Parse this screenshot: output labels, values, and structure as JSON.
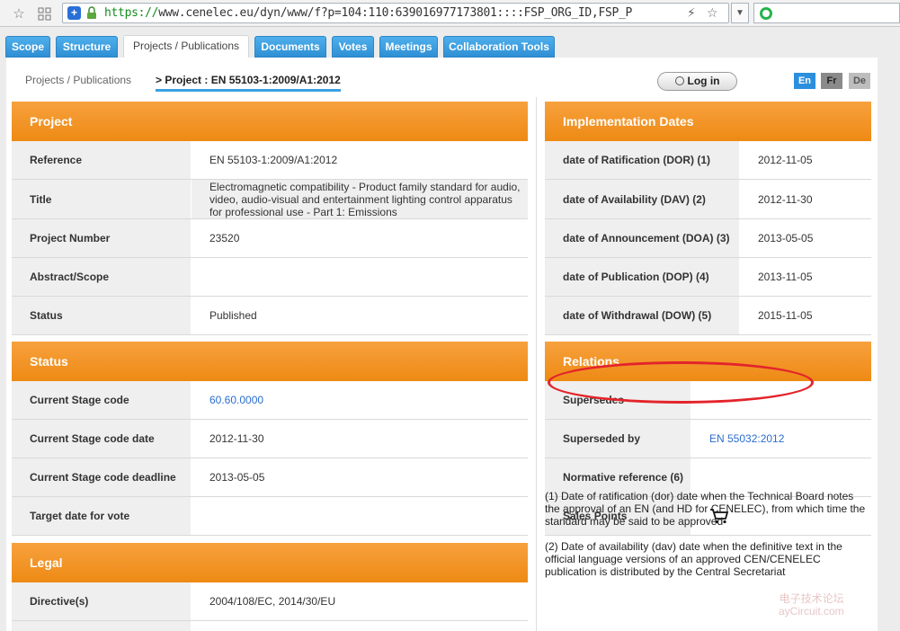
{
  "browser": {
    "url_protocol": "https://",
    "url_rest": "www.cenelec.eu/dyn/www/f?p=104:110:639016977173801::::FSP_ORG_ID,FSP_P",
    "icons": [
      "star-icon",
      "grid-icon",
      "shield-icon",
      "lock-icon",
      "bolt-icon",
      "bookmark-star-icon",
      "dropdown-icon",
      "search-engine-icon"
    ]
  },
  "tabs": [
    {
      "label": "Scope"
    },
    {
      "label": "Structure"
    },
    {
      "label": "Projects / Publications"
    },
    {
      "label": "Documents"
    },
    {
      "label": "Votes"
    },
    {
      "label": "Meetings"
    },
    {
      "label": "Collaboration Tools"
    }
  ],
  "active_tab": "Projects / Publications",
  "breadcrumb": {
    "root": "Projects / Publications",
    "current": "> Project : EN 55103-1:2009/A1:2012"
  },
  "login_label": "Log in",
  "languages": [
    "En",
    "Fr",
    "De"
  ],
  "colors": {
    "accent_orange": "#F08F1B",
    "tab_blue": "#3A9DE0",
    "link_blue": "#2B6ECF",
    "highlight_red": "#E3242B"
  },
  "project": {
    "heading": "Project",
    "rows": [
      {
        "label": "Reference",
        "value": "EN 55103-1:2009/A1:2012"
      },
      {
        "label": "Title",
        "value": "Electromagnetic compatibility - Product family standard for audio, video, audio-visual and entertainment lighting control apparatus for professional use - Part 1: Emissions"
      },
      {
        "label": "Project Number",
        "value": "23520"
      },
      {
        "label": "Abstract/Scope",
        "value": ""
      },
      {
        "label": "Status",
        "value": "Published"
      }
    ]
  },
  "status": {
    "heading": "Status",
    "rows": [
      {
        "label": "Current Stage code",
        "value": "60.60.0000"
      },
      {
        "label": "Current Stage code date",
        "value": "2012-11-30"
      },
      {
        "label": "Current Stage code deadline",
        "value": "2013-05-05"
      },
      {
        "label": "Target date for vote",
        "value": ""
      }
    ]
  },
  "legal": {
    "heading": "Legal",
    "rows": [
      {
        "label": "Directive(s)",
        "value": "2004/108/EC, 2014/30/EU"
      }
    ]
  },
  "implementation": {
    "heading": "Implementation Dates",
    "rows": [
      {
        "label": "date of Ratification (DOR) (1)",
        "value": "2012-11-05"
      },
      {
        "label": "date of Availability (DAV) (2)",
        "value": "2012-11-30"
      },
      {
        "label": "date of Announcement (DOA) (3)",
        "value": "2013-05-05"
      },
      {
        "label": "date of Publication (DOP) (4)",
        "value": "2013-11-05"
      },
      {
        "label": "date of Withdrawal (DOW) (5)",
        "value": "2015-11-05"
      }
    ]
  },
  "relations": {
    "heading": "Relations",
    "rows": [
      {
        "label": "Supersedes",
        "value": ""
      },
      {
        "label": "Superseded by",
        "value": "EN 55032:2012"
      },
      {
        "label": "Normative reference (6)",
        "value": ""
      },
      {
        "label": "Sales Points",
        "value": ""
      }
    ]
  },
  "notes": [
    "(1) Date of ratification (dor) date when the Technical Board notes the approval of an EN (and HD for CENELEC), from which time the standard may be said to be approved",
    "(2) Date of availability (dav) date when the definitive text in the official language versions of an approved CEN/CENELEC publication is distributed by the Central Secretariat"
  ],
  "watermark": {
    "line1": "电子技术论坛",
    "line2": "ayCircuit.com"
  }
}
